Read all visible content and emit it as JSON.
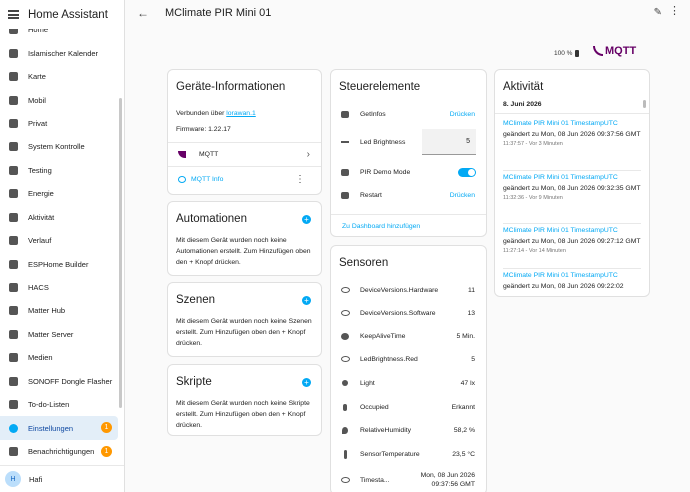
{
  "app": {
    "title": "Home Assistant"
  },
  "sidebar": {
    "items": [
      {
        "label": "Home",
        "icon": "home-icon"
      },
      {
        "label": "Islamischer Kalender",
        "icon": "dashboard-icon"
      },
      {
        "label": "Karte",
        "icon": "map-icon"
      },
      {
        "label": "Mobil",
        "icon": "phone-icon"
      },
      {
        "label": "Privat",
        "icon": "dashboard-icon"
      },
      {
        "label": "System Kontrolle",
        "icon": "dashboard-icon"
      },
      {
        "label": "Testing",
        "icon": "dashboard-icon"
      },
      {
        "label": "Energie",
        "icon": "lightning-icon"
      },
      {
        "label": "Aktivität",
        "icon": "list-icon"
      },
      {
        "label": "Verlauf",
        "icon": "chart-icon"
      },
      {
        "label": "ESPHome Builder",
        "icon": "esphome-icon"
      },
      {
        "label": "HACS",
        "icon": "hacs-icon"
      },
      {
        "label": "Matter Hub",
        "icon": "hub-icon"
      },
      {
        "label": "Matter Server",
        "icon": "server-icon"
      },
      {
        "label": "Medien",
        "icon": "media-icon"
      },
      {
        "label": "SONOFF Dongle Flasher",
        "icon": "flash-icon"
      },
      {
        "label": "To-do-Listen",
        "icon": "todo-icon"
      },
      {
        "label": "Einstellungen",
        "icon": "gear-icon",
        "badge": "1",
        "active": true
      },
      {
        "label": "Benachrichtigungen",
        "icon": "bell-icon",
        "badge": "1"
      }
    ],
    "user": {
      "initial": "H",
      "name": "Hafi"
    }
  },
  "header": {
    "title": "MClimate PIR Mini 01"
  },
  "status": {
    "battery": "100 %",
    "integration": "MQTT"
  },
  "device_info": {
    "title": "Geräte-Informationen",
    "connected_prefix": "Verbunden über ",
    "connected_link": "lorawan.1",
    "firmware": "Firmware: 1.22.17",
    "mqtt_label": "MQTT",
    "mqtt_info": "MQTT Info"
  },
  "automations": {
    "title": "Automationen",
    "text": "Mit diesem Gerät wurden noch keine Automationen erstellt. Zum Hinzufügen oben den + Knopf drücken."
  },
  "scenes": {
    "title": "Szenen",
    "text": "Mit diesem Gerät wurden noch keine Szenen erstellt. Zum Hinzufügen oben den + Knopf drücken."
  },
  "scripts": {
    "title": "Skripte",
    "text": "Mit diesem Gerät wurden noch keine Skripte erstellt. Zum Hinzufügen oben den + Knopf drücken."
  },
  "controls": {
    "title": "Steuerelemente",
    "getinfos": {
      "label": "GetInfos",
      "action": "Drücken"
    },
    "led": {
      "label": "Led Brightness",
      "value": "5"
    },
    "pir": {
      "label": "PIR Demo Mode"
    },
    "restart": {
      "label": "Restart",
      "action": "Drücken"
    },
    "add_dashboard": "Zu Dashboard hinzufügen"
  },
  "sensors": {
    "title": "Sensoren",
    "rows": [
      {
        "label": "DeviceVersions.Hardware",
        "value": "11",
        "icon": "eye-icon"
      },
      {
        "label": "DeviceVersions.Software",
        "value": "13",
        "icon": "eye-icon"
      },
      {
        "label": "KeepAliveTime",
        "value": "5 Min.",
        "icon": "clock-icon"
      },
      {
        "label": "LedBrightness.Red",
        "value": "5",
        "icon": "eye-icon"
      },
      {
        "label": "Light",
        "value": "47 lx",
        "icon": "brightness-icon"
      },
      {
        "label": "Occupied",
        "value": "Erkannt",
        "icon": "motion-icon"
      },
      {
        "label": "RelativeHumidity",
        "value": "58,2 %",
        "icon": "humidity-icon"
      },
      {
        "label": "SensorTemperature",
        "value": "23,5 °C",
        "icon": "thermometer-icon"
      },
      {
        "label": "Timesta...",
        "value": "Mon, 08 Jun 2026 09:37:56 GMT",
        "icon": "eye-icon"
      }
    ]
  },
  "activity": {
    "title": "Aktivität",
    "date": "8. Juni 2026",
    "entries": [
      {
        "title": "MClimate PIR Mini 01 TimestampUTC",
        "desc": "geändert zu Mon, 08 Jun 2026 09:37:56 GMT",
        "meta": "11:37:57 - Vor 3 Minuten"
      },
      {
        "title": "MClimate PIR Mini 01 TimestampUTC",
        "desc": "geändert zu Mon, 08 Jun 2026 09:32:35 GMT",
        "meta": "11:32:36 - Vor 9 Minuten"
      },
      {
        "title": "MClimate PIR Mini 01 TimestampUTC",
        "desc": "geändert zu Mon, 08 Jun 2026 09:27:12 GMT",
        "meta": "11:27:14 - Vor 14 Minuten"
      },
      {
        "title": "MClimate PIR Mini 01 TimestampUTC",
        "desc": "geändert zu Mon, 08 Jun 2026 09:22:02",
        "meta": ""
      }
    ]
  },
  "colors": {
    "accent": "#03a9f4",
    "badge": "#ff9800",
    "mqtt": "#660066"
  }
}
